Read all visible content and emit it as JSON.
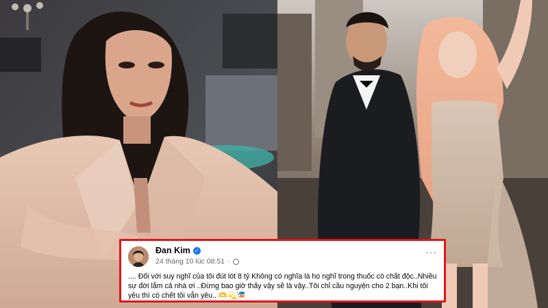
{
  "post": {
    "author": "Đan Kim",
    "timestamp": "24 tháng 10 lúc 08:51",
    "privacy_symbol": "·",
    "more_label": "···",
    "text": ".... Đối với suy nghĩ của tôi đút lót 8 tỷ Không có nghĩa là họ nghĩ trong thuốc có chất độc..Nhiều sự đời lắm cả nhà ơi ..Đừng bao giờ thấy vậy sẽ là vậy..Tôi chỉ cầu nguyện cho 2 bạn..Khi tôi yêu thì có chết tôi vẫn yêu.. 🫶💫🎏",
    "border_color": "#e0141a"
  },
  "icons": {
    "verified": "verified-check-icon",
    "privacy": "globe-icon",
    "more": "more-options-icon"
  }
}
